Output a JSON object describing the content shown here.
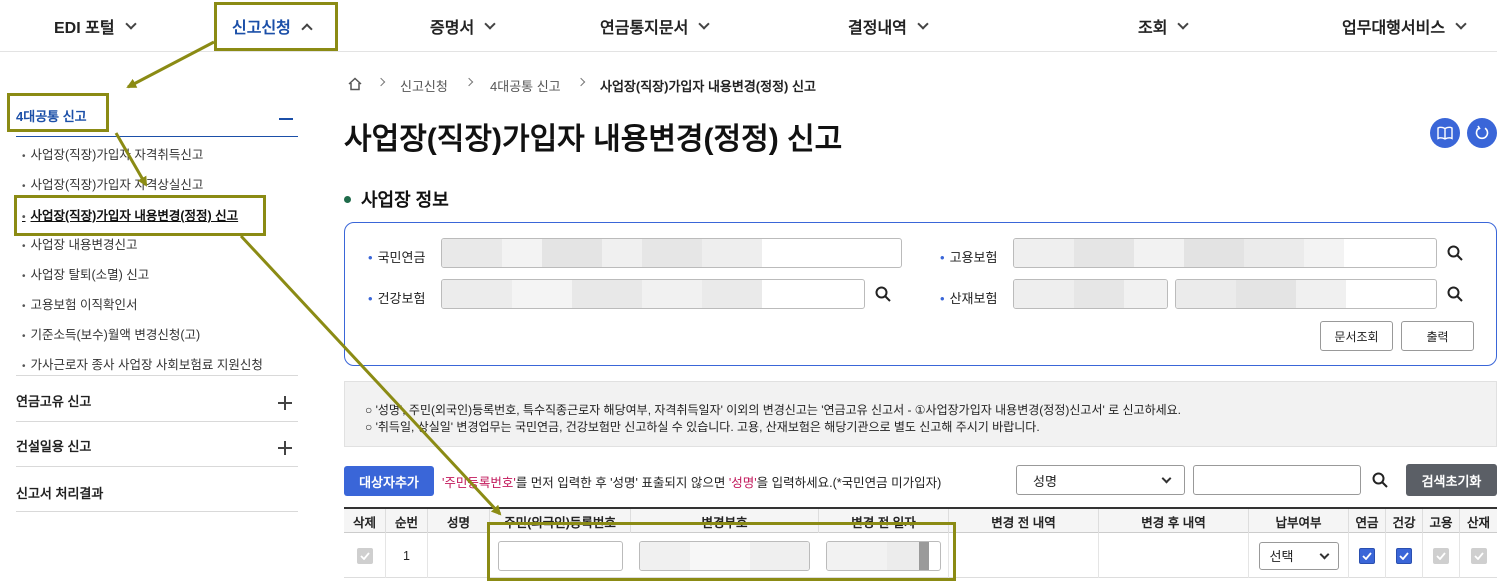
{
  "nav": {
    "items": [
      {
        "label": "EDI 포털"
      },
      {
        "label": "신고신청"
      },
      {
        "label": "증명서"
      },
      {
        "label": "연금통지문서"
      },
      {
        "label": "결정내역"
      },
      {
        "label": "조회"
      },
      {
        "label": "업무대행서비스"
      }
    ]
  },
  "sidebar": {
    "group1": "4대공통 신고",
    "subitems": [
      "사업장(직장)가입자 자격취득신고",
      "사업장(직장)가입자 자격상실신고",
      "사업장(직장)가입자 내용변경(정정) 신고",
      "사업장 내용변경신고",
      "사업장 탈퇴(소멸) 신고",
      "고용보험 이직확인서",
      "기준소득(보수)월액 변경신청(고)",
      "가사근로자 종사 사업장 사회보험료 지원신청"
    ],
    "group2": "연금고유 신고",
    "group3": "건설일용 신고",
    "group4": "신고서 처리결과"
  },
  "breadcrumb": {
    "level1": "신고신청",
    "level2": "4대공통 신고",
    "current": "사업장(직장)가입자 내용변경(정정) 신고"
  },
  "page_title": "사업장(직장)가입자 내용변경(정정) 신고",
  "section_title": "사업장 정보",
  "fields": {
    "pension": "국민연금",
    "health": "건강보험",
    "employment": "고용보험",
    "industrial": "산재보험"
  },
  "buttons": {
    "doc_lookup": "문서조회",
    "print": "출력",
    "add_target": "대상자추가",
    "reset_search": "검색초기화"
  },
  "notice": {
    "line1": "○ '성명', 주민(외국인)등록번호, 특수직종근로자 해당여부, 자격취득일자' 이외의 변경신고는 '연금고유 신고서 - ①사업장가입자 내용변경(정정)신고서' 로 신고하세요.",
    "line2": "○ '취득일, 상실일' 변경업무는 국민연금, 건강보험만 신고하실 수 있습니다. 고용, 산재보험은 해당기관으로 별도 신고해 주시기 바랍니다."
  },
  "hint": {
    "part1": "'주민등록번호'",
    "part2": "를 먼저 입력한 후 '성명' 표출되지 않으면 ",
    "part3": "'성명'",
    "part4": "을 입력하세요.(*국민연금 미가입자)"
  },
  "search": {
    "select_value": "성명"
  },
  "table": {
    "headers": [
      "삭제",
      "순번",
      "성명",
      "주민(외국인)등록번호",
      "변경부호",
      "변경 전 일자",
      "변경 전 내역",
      "변경 후 내역",
      "납부여부",
      "연금",
      "건강",
      "고용",
      "산재"
    ],
    "rows": [
      {
        "seq": "1",
        "payment_select": "선택"
      }
    ]
  },
  "colors": {
    "accent": "#3a66d8",
    "annotation": "#8b8b14"
  }
}
